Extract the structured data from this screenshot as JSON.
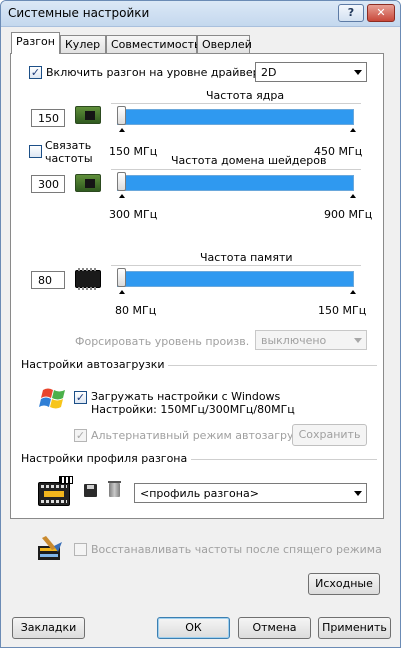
{
  "window": {
    "title": "Системные настройки",
    "help_label": "?",
    "close_label": "✕"
  },
  "tabs": [
    {
      "label": "Разгон",
      "active": true
    },
    {
      "label": "Кулер"
    },
    {
      "label": "Совместимость"
    },
    {
      "label": "Оверлей"
    }
  ],
  "driver_oc": {
    "checkbox_label": "Включить разгон на уровне драйвера",
    "checked": true,
    "mode_value": "2D"
  },
  "link_clocks": {
    "label_line1": "Связать",
    "label_line2": "частоты",
    "checked": false
  },
  "sliders": {
    "core": {
      "title": "Частота ядра",
      "value": "150",
      "min_label": "150 МГц",
      "max_label": "450 МГц",
      "position": 0.0
    },
    "shader": {
      "title": "Частота домена шейдеров",
      "value": "300",
      "min_label": "300 МГц",
      "max_label": "900 МГц",
      "position": 0.0
    },
    "memory": {
      "title": "Частота памяти",
      "value": "80",
      "min_label": "80 МГц",
      "max_label": "150 МГц",
      "position": 0.0
    }
  },
  "force_perf": {
    "label": "Форсировать уровень произв.",
    "value": "выключено"
  },
  "autoload": {
    "group_title": "Настройки автозагрузки",
    "checkbox_label": "Загружать настройки с Windows",
    "checked": true,
    "settings_text": "Настройки: 150МГц/300МГц/80МГц",
    "alt_label": "Альтернативный режим автозагрузки",
    "alt_checked": true,
    "save_label": "Сохранить"
  },
  "profile": {
    "group_title": "Настройки профиля разгона",
    "combo_value": "<профиль разгона>"
  },
  "restore": {
    "label": "Восстанавливать частоты после спящего режима",
    "checked": false
  },
  "buttons": {
    "defaults": "Исходные",
    "bookmarks": "Закладки",
    "ok": "ОК",
    "cancel": "Отмена",
    "apply": "Применить"
  },
  "colors": {
    "slider_track": "#2f99f0",
    "title_bar": "#c4d8ee",
    "close_button": "#c8483a"
  }
}
